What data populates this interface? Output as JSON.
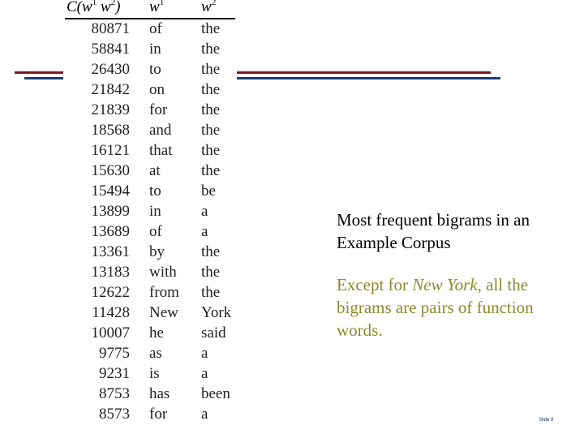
{
  "table": {
    "headers": {
      "count": {
        "base": "C(w",
        "sup1": "1",
        "mid": " w",
        "sup2": "2",
        "end": ")"
      },
      "w1": {
        "base": "w",
        "sup": "1"
      },
      "w2": {
        "base": "w",
        "sup": "2"
      }
    },
    "rows": [
      {
        "count": "80871",
        "w1": "of",
        "w2": "the"
      },
      {
        "count": "58841",
        "w1": "in",
        "w2": "the"
      },
      {
        "count": "26430",
        "w1": "to",
        "w2": "the"
      },
      {
        "count": "21842",
        "w1": "on",
        "w2": "the"
      },
      {
        "count": "21839",
        "w1": "for",
        "w2": "the"
      },
      {
        "count": "18568",
        "w1": "and",
        "w2": "the"
      },
      {
        "count": "16121",
        "w1": "that",
        "w2": "the"
      },
      {
        "count": "15630",
        "w1": "at",
        "w2": "the"
      },
      {
        "count": "15494",
        "w1": "to",
        "w2": "be"
      },
      {
        "count": "13899",
        "w1": "in",
        "w2": "a"
      },
      {
        "count": "13689",
        "w1": "of",
        "w2": "a"
      },
      {
        "count": "13361",
        "w1": "by",
        "w2": "the"
      },
      {
        "count": "13183",
        "w1": "with",
        "w2": "the"
      },
      {
        "count": "12622",
        "w1": "from",
        "w2": "the"
      },
      {
        "count": "11428",
        "w1": "New",
        "w2": "York"
      },
      {
        "count": "10007",
        "w1": "he",
        "w2": "said"
      },
      {
        "count": "9775",
        "w1": "as",
        "w2": "a"
      },
      {
        "count": "9231",
        "w1": "is",
        "w2": "a"
      },
      {
        "count": "8753",
        "w1": "has",
        "w2": "been"
      },
      {
        "count": "8573",
        "w1": "for",
        "w2": "a"
      }
    ]
  },
  "caption": {
    "line1": "Most frequent bigrams in an",
    "line2": "Example Corpus"
  },
  "note": {
    "before": "Except for ",
    "emphasis": "New York",
    "after": ", all the bigrams are pairs of function words."
  },
  "slide_number": "Slide 8",
  "colors": {
    "rule_red": "#7a1a1f",
    "rule_blue": "#1c3f7c",
    "note_text": "#8a8a2a"
  }
}
